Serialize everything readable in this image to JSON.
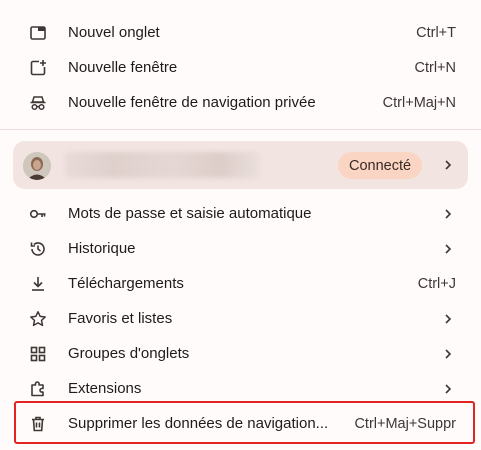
{
  "menu": {
    "new_tab": {
      "label": "Nouvel onglet",
      "shortcut": "Ctrl+T",
      "icon": "new-tab-icon"
    },
    "new_window": {
      "label": "Nouvelle fenêtre",
      "shortcut": "Ctrl+N",
      "icon": "new-window-icon"
    },
    "new_private": {
      "label": "Nouvelle fenêtre de navigation privée",
      "shortcut": "Ctrl+Maj+N",
      "icon": "incognito-icon"
    },
    "profile": {
      "status": "Connecté"
    },
    "passwords": {
      "label": "Mots de passe et saisie automatique",
      "icon": "key-icon"
    },
    "history": {
      "label": "Historique",
      "icon": "history-icon"
    },
    "downloads": {
      "label": "Téléchargements",
      "shortcut": "Ctrl+J",
      "icon": "download-icon"
    },
    "bookmarks": {
      "label": "Favoris et listes",
      "icon": "star-icon"
    },
    "tab_groups": {
      "label": "Groupes d'onglets",
      "icon": "tab-groups-icon"
    },
    "extensions": {
      "label": "Extensions",
      "icon": "puzzle-icon"
    },
    "clear_data": {
      "label": "Supprimer les données de navigation...",
      "shortcut": "Ctrl+Maj+Suppr",
      "icon": "trash-icon"
    }
  },
  "colors": {
    "background": "#fffbfa",
    "profile_bg": "#f2e4e0",
    "status_bg": "#fbd5c4",
    "highlight": "#e32222"
  }
}
